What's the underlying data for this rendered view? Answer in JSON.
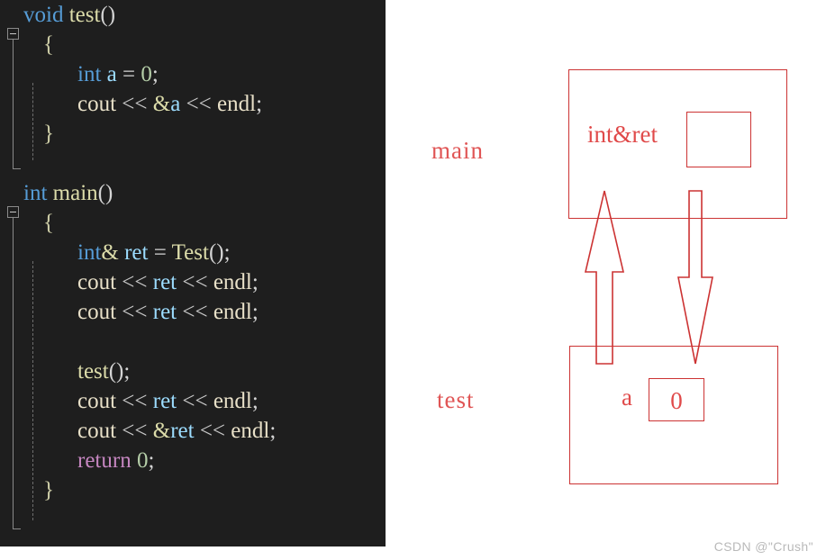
{
  "code_panel": {
    "language": "cpp",
    "background": "#1e1e1e",
    "lines": [
      {
        "indent": 0,
        "tokens": [
          {
            "text": "void",
            "cls": "t-kw"
          },
          {
            "text": " ",
            "cls": "t-op"
          },
          {
            "text": "test",
            "cls": "t-fn"
          },
          {
            "text": "()",
            "cls": "t-op"
          }
        ]
      },
      {
        "indent": 1,
        "tokens": [
          {
            "text": "{",
            "cls": "t-brace"
          }
        ]
      },
      {
        "indent": 2,
        "tokens": [
          {
            "text": "int",
            "cls": "t-kw"
          },
          {
            "text": " ",
            "cls": "t-op"
          },
          {
            "text": "a",
            "cls": "t-var"
          },
          {
            "text": " = ",
            "cls": "t-op"
          },
          {
            "text": "0",
            "cls": "t-num"
          },
          {
            "text": ";",
            "cls": "t-op"
          }
        ]
      },
      {
        "indent": 2,
        "tokens": [
          {
            "text": "cout",
            "cls": "t-stream"
          },
          {
            "text": " ",
            "cls": "t-op"
          },
          {
            "text": "<<",
            "cls": "t-shift"
          },
          {
            "text": " ",
            "cls": "t-op"
          },
          {
            "text": "&",
            "cls": "t-amp"
          },
          {
            "text": "a",
            "cls": "t-var"
          },
          {
            "text": " ",
            "cls": "t-op"
          },
          {
            "text": "<<",
            "cls": "t-shift"
          },
          {
            "text": " ",
            "cls": "t-op"
          },
          {
            "text": "endl",
            "cls": "t-stream"
          },
          {
            "text": ";",
            "cls": "t-op"
          }
        ]
      },
      {
        "indent": 1,
        "tokens": [
          {
            "text": "}",
            "cls": "t-brace"
          }
        ]
      },
      {
        "indent": 0,
        "tokens": [
          {
            "text": "",
            "cls": "t-op"
          }
        ]
      },
      {
        "indent": 0,
        "tokens": [
          {
            "text": "int",
            "cls": "t-kw"
          },
          {
            "text": " ",
            "cls": "t-op"
          },
          {
            "text": "main",
            "cls": "t-fn"
          },
          {
            "text": "()",
            "cls": "t-op"
          }
        ]
      },
      {
        "indent": 1,
        "tokens": [
          {
            "text": "{",
            "cls": "t-brace"
          }
        ]
      },
      {
        "indent": 2,
        "tokens": [
          {
            "text": "int",
            "cls": "t-kw"
          },
          {
            "text": "&",
            "cls": "t-amp"
          },
          {
            "text": " ",
            "cls": "t-op"
          },
          {
            "text": "ret",
            "cls": "t-var"
          },
          {
            "text": " = ",
            "cls": "t-op"
          },
          {
            "text": "Test",
            "cls": "t-fn"
          },
          {
            "text": "();",
            "cls": "t-op"
          }
        ]
      },
      {
        "indent": 2,
        "tokens": [
          {
            "text": "cout",
            "cls": "t-stream"
          },
          {
            "text": " ",
            "cls": "t-op"
          },
          {
            "text": "<<",
            "cls": "t-shift"
          },
          {
            "text": " ",
            "cls": "t-op"
          },
          {
            "text": "ret",
            "cls": "t-var"
          },
          {
            "text": " ",
            "cls": "t-op"
          },
          {
            "text": "<<",
            "cls": "t-shift"
          },
          {
            "text": " ",
            "cls": "t-op"
          },
          {
            "text": "endl",
            "cls": "t-stream"
          },
          {
            "text": ";",
            "cls": "t-op"
          }
        ]
      },
      {
        "indent": 2,
        "tokens": [
          {
            "text": "cout",
            "cls": "t-stream"
          },
          {
            "text": " ",
            "cls": "t-op"
          },
          {
            "text": "<<",
            "cls": "t-shift"
          },
          {
            "text": " ",
            "cls": "t-op"
          },
          {
            "text": "ret",
            "cls": "t-var"
          },
          {
            "text": " ",
            "cls": "t-op"
          },
          {
            "text": "<<",
            "cls": "t-shift"
          },
          {
            "text": " ",
            "cls": "t-op"
          },
          {
            "text": "endl",
            "cls": "t-stream"
          },
          {
            "text": ";",
            "cls": "t-op"
          }
        ]
      },
      {
        "indent": 0,
        "tokens": [
          {
            "text": "",
            "cls": "t-op"
          }
        ]
      },
      {
        "indent": 2,
        "tokens": [
          {
            "text": "test",
            "cls": "t-fn"
          },
          {
            "text": "();",
            "cls": "t-op"
          }
        ]
      },
      {
        "indent": 2,
        "tokens": [
          {
            "text": "cout",
            "cls": "t-stream"
          },
          {
            "text": " ",
            "cls": "t-op"
          },
          {
            "text": "<<",
            "cls": "t-shift"
          },
          {
            "text": " ",
            "cls": "t-op"
          },
          {
            "text": "ret",
            "cls": "t-var"
          },
          {
            "text": " ",
            "cls": "t-op"
          },
          {
            "text": "<<",
            "cls": "t-shift"
          },
          {
            "text": " ",
            "cls": "t-op"
          },
          {
            "text": "endl",
            "cls": "t-stream"
          },
          {
            "text": ";",
            "cls": "t-op"
          }
        ]
      },
      {
        "indent": 2,
        "tokens": [
          {
            "text": "cout",
            "cls": "t-stream"
          },
          {
            "text": " ",
            "cls": "t-op"
          },
          {
            "text": "<<",
            "cls": "t-shift"
          },
          {
            "text": " ",
            "cls": "t-op"
          },
          {
            "text": "&",
            "cls": "t-amp"
          },
          {
            "text": "ret",
            "cls": "t-var"
          },
          {
            "text": " ",
            "cls": "t-op"
          },
          {
            "text": "<<",
            "cls": "t-shift"
          },
          {
            "text": " ",
            "cls": "t-op"
          },
          {
            "text": "endl",
            "cls": "t-stream"
          },
          {
            "text": ";",
            "cls": "t-op"
          }
        ]
      },
      {
        "indent": 2,
        "tokens": [
          {
            "text": "return",
            "cls": "t-ret"
          },
          {
            "text": " ",
            "cls": "t-op"
          },
          {
            "text": "0",
            "cls": "t-num"
          },
          {
            "text": ";",
            "cls": "t-op"
          }
        ]
      },
      {
        "indent": 1,
        "tokens": [
          {
            "text": "}",
            "cls": "t-brace"
          }
        ]
      }
    ],
    "plain_text": "void test()\n{\n    int a = 0;\n    cout << &a << endl;\n}\n\nint main()\n{\n    int& ret = Test();\n    cout << ret << endl;\n    cout << ret << endl;\n\n    test();\n    cout << ret << endl;\n    cout << &ret << endl;\n    return 0;\n}",
    "outlining": [
      {
        "name": "collapse-toggle-test",
        "label": "-"
      },
      {
        "name": "collapse-toggle-main",
        "label": "-"
      }
    ]
  },
  "diagram": {
    "accent_color": "#cc3333",
    "frames": [
      {
        "id": "main",
        "label": "main",
        "slot_label": "int&ret",
        "slot_value": ""
      },
      {
        "id": "test",
        "label": "test",
        "slot_label": "a",
        "slot_value": "0"
      }
    ],
    "arrows": [
      {
        "id": "return-arrow",
        "direction": "up",
        "from": "test",
        "to": "main"
      },
      {
        "id": "call-arrow",
        "direction": "down",
        "from": "main",
        "to": "test"
      }
    ]
  },
  "watermark": {
    "text": "CSDN @\"Crush\""
  }
}
